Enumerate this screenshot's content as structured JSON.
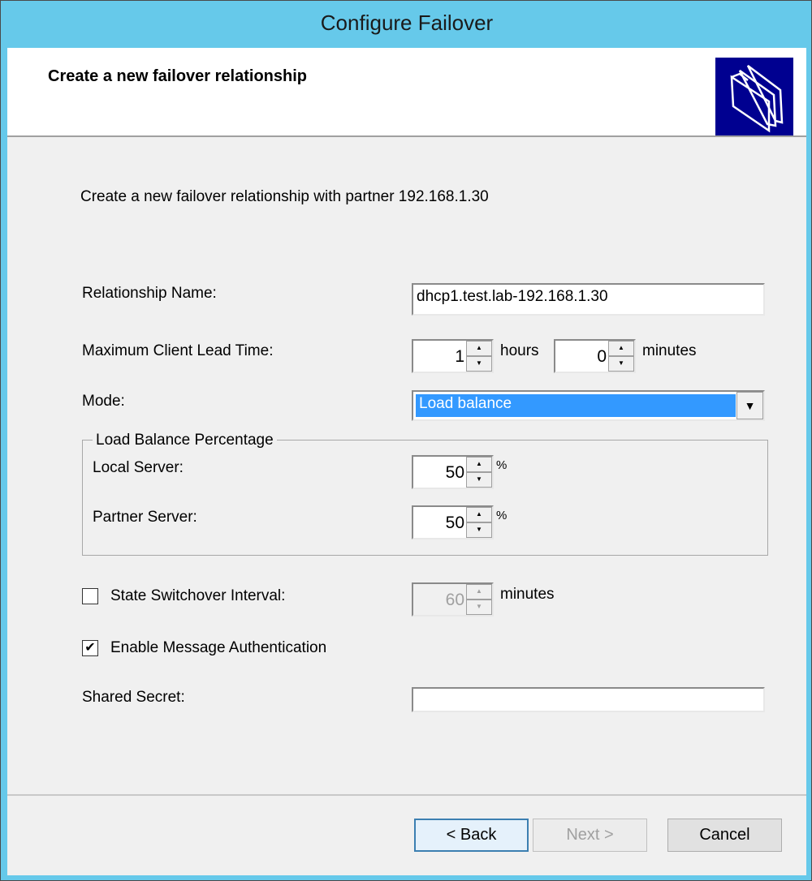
{
  "window": {
    "title": "Configure Failover"
  },
  "header": {
    "title": "Create a new failover relationship",
    "icon": "folders-icon"
  },
  "intro": "Create a new failover relationship with partner 192.168.1.30",
  "relationship_name": {
    "label": "Relationship Name:",
    "value": "dhcp1.test.lab-192.168.1.30"
  },
  "lead_time": {
    "label": "Maximum Client Lead Time:",
    "hours": "1",
    "hours_unit": "hours",
    "minutes": "0",
    "minutes_unit": "minutes"
  },
  "mode": {
    "label": "Mode:",
    "value": "Load balance"
  },
  "load_balance": {
    "legend": "Load Balance Percentage",
    "local_label": "Local Server:",
    "local_value": "50",
    "partner_label": "Partner Server:",
    "partner_value": "50",
    "unit": "%"
  },
  "switchover": {
    "label": "State Switchover Interval:",
    "checked": false,
    "value": "60",
    "unit": "minutes",
    "enabled": false
  },
  "auth": {
    "label": "Enable Message Authentication",
    "checked": true,
    "check_mark": "✔"
  },
  "shared_secret": {
    "label": "Shared Secret:",
    "value": ""
  },
  "buttons": {
    "back": "< Back",
    "next": "Next >",
    "cancel": "Cancel"
  },
  "colors": {
    "title_bar": "#66c9ea",
    "selection": "#3399ff"
  }
}
